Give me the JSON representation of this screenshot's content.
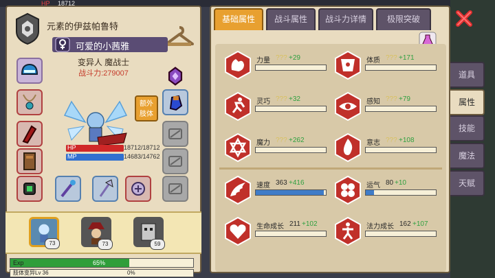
{
  "hud": {
    "hp_header": "HP",
    "hp_header_value": "18712"
  },
  "guild": {
    "name": "元素的伊兹帕鲁特"
  },
  "character": {
    "name": "可爱的小茜雅",
    "race_class": "变异人 魔战士",
    "power": "战斗力:279007",
    "hp_label": "HP",
    "hp_value": "18712/18712",
    "hp_fraction": 1.0,
    "mp_label": "MP",
    "mp_value": "14683/14762",
    "mp_fraction": 0.995,
    "extra_limb_label": "额外\n肢体"
  },
  "party": [
    {
      "level": "73",
      "selected": true
    },
    {
      "level": "73",
      "selected": false
    },
    {
      "level": "59",
      "selected": false
    }
  ],
  "exp": {
    "label": "Exp",
    "percent": "65%",
    "fraction": 0.65,
    "sub_label": "肢体变异Lv 36",
    "sub_percent": "0%",
    "sub_fraction": 0.0
  },
  "tabs": [
    {
      "label": "基础属性",
      "active": true
    },
    {
      "label": "战斗属性",
      "active": false
    },
    {
      "label": "战斗力详情",
      "active": false
    },
    {
      "label": "极限突破",
      "active": false
    }
  ],
  "stats": [
    {
      "name": "力量",
      "base": "???",
      "bonus": "+29",
      "fraction": 0.0,
      "icon": "muscle-arm-icon"
    },
    {
      "name": "体质",
      "base": "???",
      "bonus": "+171",
      "fraction": 0.0,
      "icon": "torso-icon"
    },
    {
      "name": "灵巧",
      "base": "???",
      "bonus": "+32",
      "fraction": 0.0,
      "icon": "running-figure-icon"
    },
    {
      "name": "感知",
      "base": "???",
      "bonus": "+79",
      "fraction": 0.0,
      "icon": "eye-icon"
    },
    {
      "name": "魔力",
      "base": "???",
      "bonus": "+262",
      "fraction": 0.0,
      "icon": "hexagram-icon"
    },
    {
      "name": "意志",
      "base": "???",
      "bonus": "+108",
      "fraction": 0.0,
      "icon": "flame-icon"
    },
    {
      "name": "速度",
      "base": "363",
      "bonus": "+416",
      "fraction": 0.97,
      "icon": "wing-icon"
    },
    {
      "name": "运气",
      "base": "80",
      "bonus": "+10",
      "fraction": 0.12,
      "icon": "clover-icon"
    },
    {
      "name": "生命成长",
      "base": "211",
      "bonus": "+102",
      "fraction": 0.0,
      "icon": "heart-icon"
    },
    {
      "name": "法力成长",
      "base": "162",
      "bonus": "+107",
      "fraction": 0.0,
      "icon": "mage-figure-icon"
    }
  ],
  "side_tabs": [
    {
      "label": "道具",
      "active": false
    },
    {
      "label": "属性",
      "active": true
    },
    {
      "label": "技能",
      "active": false
    },
    {
      "label": "魔法",
      "active": false
    },
    {
      "label": "天赋",
      "active": false
    }
  ],
  "colors": {
    "accent": "#e8a030",
    "panel": "#e9dcc0",
    "stat_icon": "#c0302a",
    "bar": "#3f7cc8",
    "bonus": "#2fa040"
  }
}
